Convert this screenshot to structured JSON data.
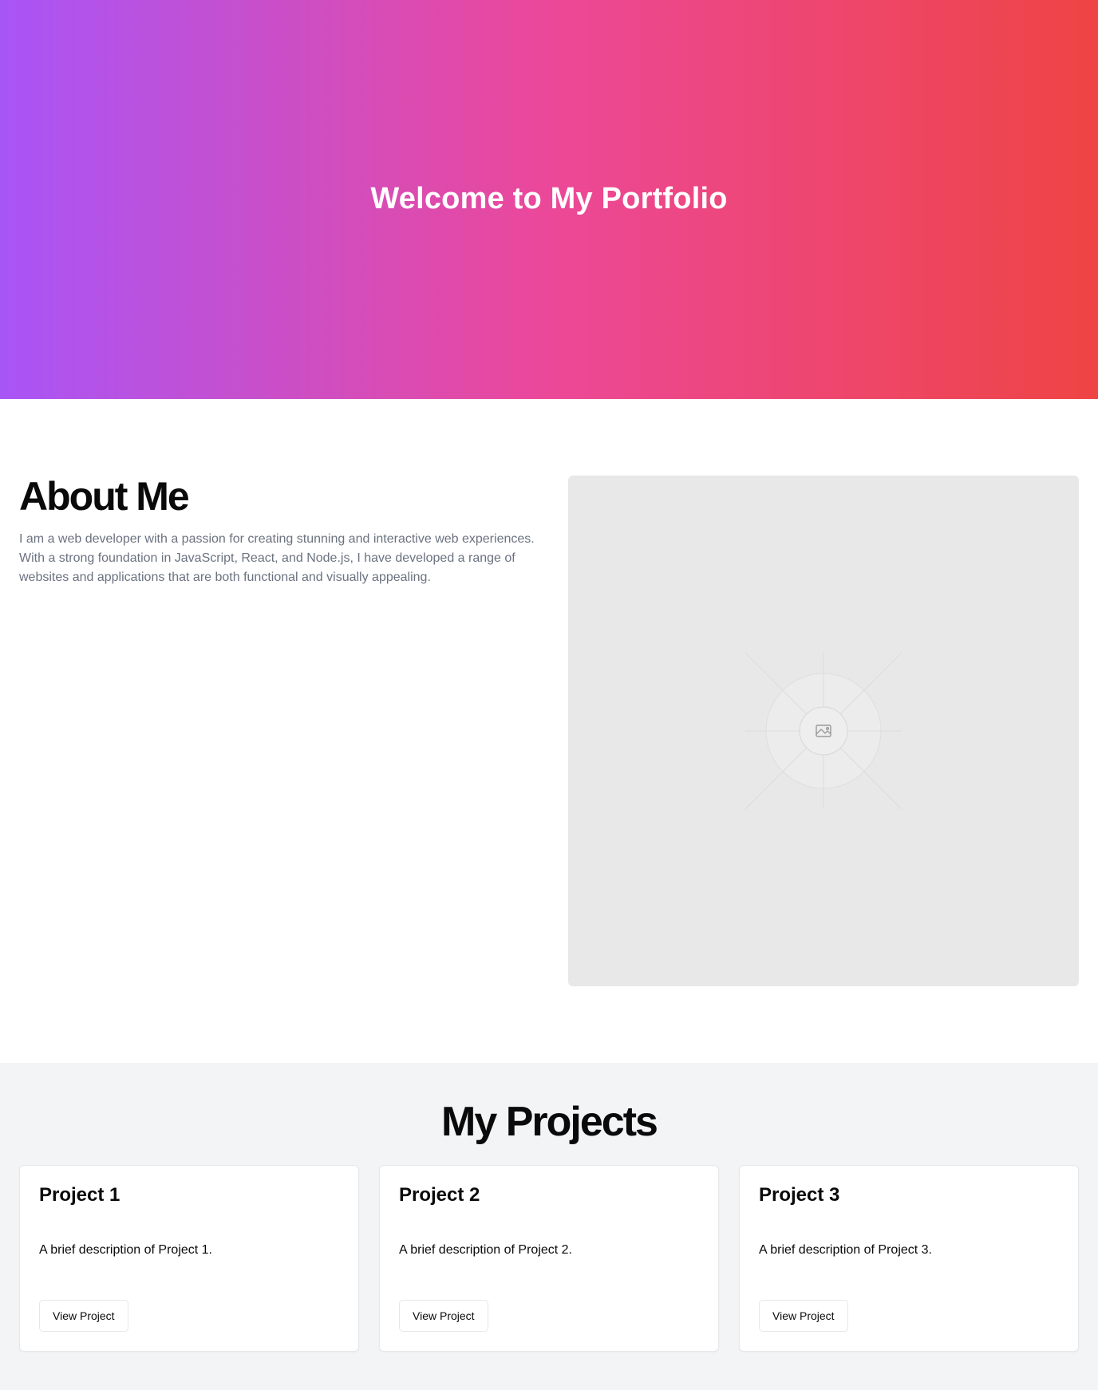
{
  "hero": {
    "title": "Welcome to My Portfolio",
    "gradient_colors": [
      "#a855f7",
      "#ec4899",
      "#ef4444"
    ]
  },
  "about": {
    "heading": "About Me",
    "body": "I am a web developer with a passion for creating stunning and interactive web experiences. With a strong foundation in JavaScript, React, and Node.js, I have developed a range of websites and applications that are both functional and visually appealing.",
    "image_icon": "image-placeholder-icon"
  },
  "projects": {
    "heading": "My Projects",
    "items": [
      {
        "title": "Project 1",
        "description": "A brief description of Project 1.",
        "button_label": "View Project"
      },
      {
        "title": "Project 2",
        "description": "A brief description of Project 2.",
        "button_label": "View Project"
      },
      {
        "title": "Project 3",
        "description": "A brief description of Project 3.",
        "button_label": "View Project"
      }
    ]
  }
}
